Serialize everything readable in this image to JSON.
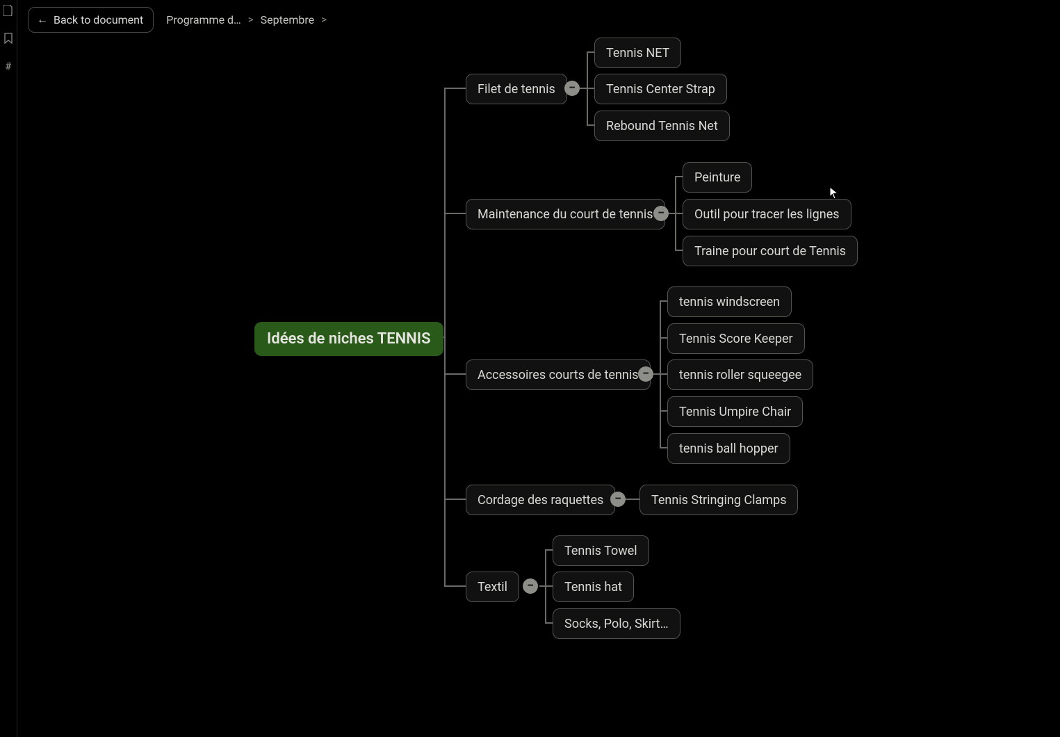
{
  "header": {
    "back_label": "Back to document",
    "breadcrumbs": [
      "Programme d…",
      "Septembre"
    ]
  },
  "rail_icons": [
    "doc",
    "bookmark",
    "hash"
  ],
  "mindmap": {
    "root": "Idées de niches TENNIS",
    "branches": [
      {
        "label": "Filet de tennis",
        "children": [
          "Tennis NET",
          "Tennis Center Strap",
          "Rebound Tennis Net"
        ]
      },
      {
        "label": "Maintenance du court de tennis",
        "children": [
          "Peinture",
          "Outil pour tracer les lignes",
          "Traine pour court de Tennis"
        ]
      },
      {
        "label": "Accessoires courts de tennis",
        "children": [
          "tennis windscreen",
          "Tennis Score Keeper",
          "tennis roller squeegee",
          "Tennis Umpire Chair",
          "tennis ball hopper"
        ]
      },
      {
        "label": "Cordage des raquettes",
        "children": [
          "Tennis Stringing Clamps"
        ]
      },
      {
        "label": "Textil",
        "children": [
          "Tennis Towel",
          "Tennis hat",
          "Socks, Polo, Skirt…"
        ]
      }
    ]
  },
  "toggle_glyph": "−"
}
